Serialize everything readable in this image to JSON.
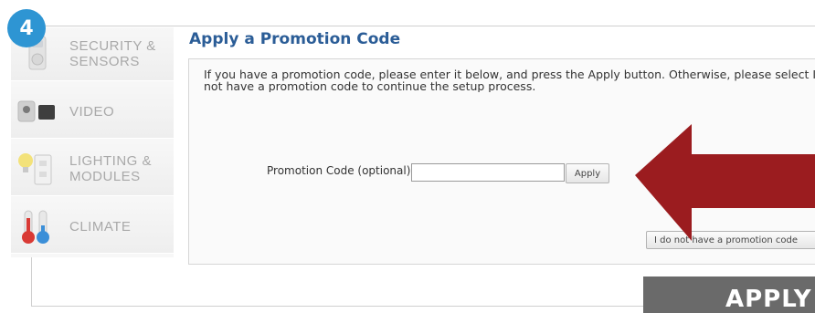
{
  "step": {
    "number": "4"
  },
  "sidebar": {
    "items": [
      {
        "label": "SECURITY &\nSENSORS",
        "icon": "security-sensor-icon"
      },
      {
        "label": "VIDEO",
        "icon": "video-camera-icon"
      },
      {
        "label": "LIGHTING &\nMODULES",
        "icon": "lighting-module-icon"
      },
      {
        "label": "CLIMATE",
        "icon": "thermometer-icon"
      }
    ]
  },
  "main": {
    "title": "Apply a Promotion Code",
    "message_line1": "If you have a promotion code, please enter it below, and press the Apply button. Otherwise, please select I do",
    "message_line2": "not have a promotion code to continue the setup process.",
    "promo_label": "Promotion Code (optional)",
    "promo_value": "",
    "apply_label": "Apply",
    "no_promo_label": "I do not have a promotion code"
  },
  "banner": {
    "text": "APPLY"
  },
  "colors": {
    "badge": "#2e95d3",
    "title": "#2b5d97",
    "arrow": "#9b1c1f",
    "banner": "#6a6a6a"
  }
}
